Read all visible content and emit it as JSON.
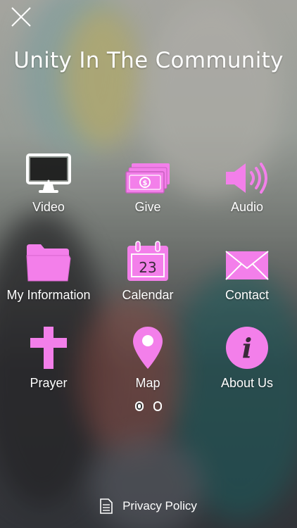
{
  "app": {
    "title": "Unity In The Community"
  },
  "menu": {
    "items": [
      {
        "label": "Video",
        "icon": "monitor-icon"
      },
      {
        "label": "Give",
        "icon": "money-icon"
      },
      {
        "label": "Audio",
        "icon": "speaker-icon"
      },
      {
        "label": "My Information",
        "icon": "folder-icon"
      },
      {
        "label": "Calendar",
        "icon": "calendar-icon",
        "day": "23"
      },
      {
        "label": "Contact",
        "icon": "envelope-icon"
      },
      {
        "label": "Prayer",
        "icon": "cross-icon"
      },
      {
        "label": "Map",
        "icon": "map-pin-icon"
      },
      {
        "label": "About Us",
        "icon": "info-icon"
      }
    ]
  },
  "pagination": {
    "current": 1,
    "total": 2
  },
  "footer": {
    "privacy_label": "Privacy Policy",
    "icon": "document-icon"
  },
  "colors": {
    "accent": "#F37FEA",
    "text": "#FFFFFF"
  }
}
